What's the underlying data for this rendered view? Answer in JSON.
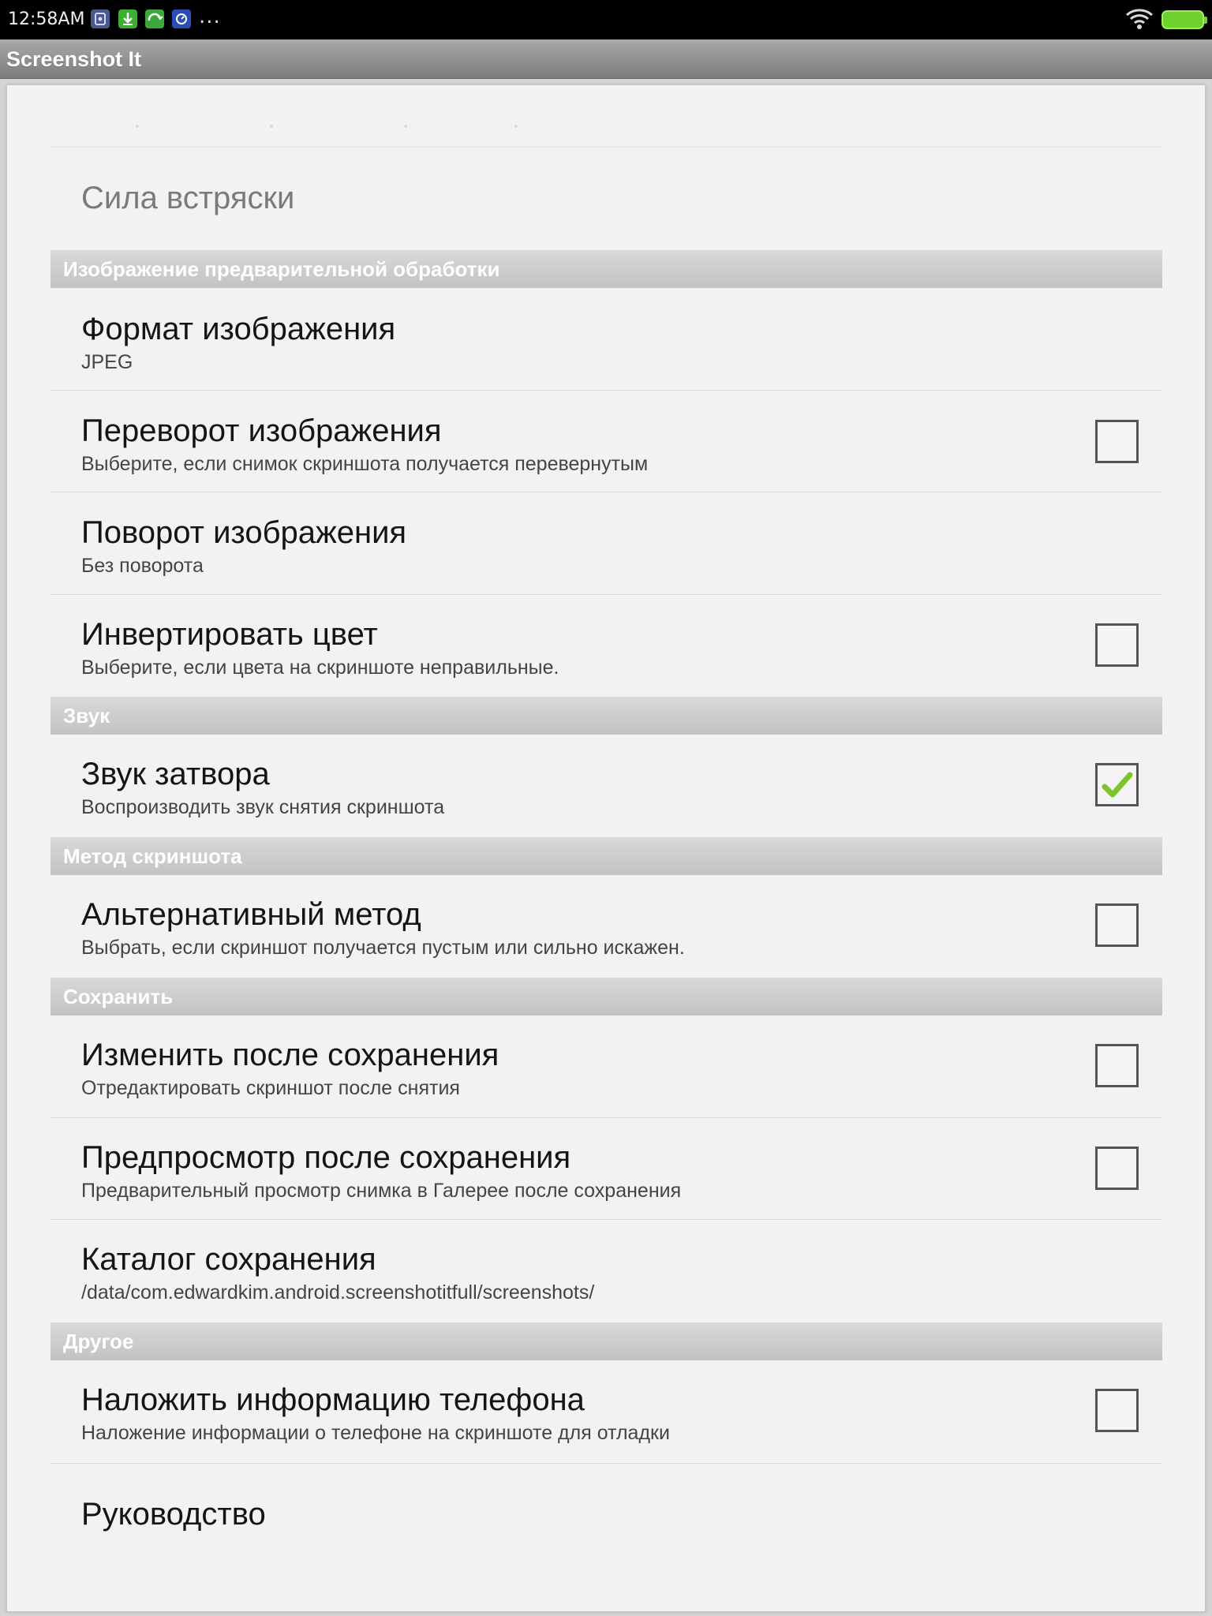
{
  "status_bar": {
    "time": "12:58AM",
    "overflow": "...",
    "notification_icons": [
      "screenshot-icon",
      "download-icon",
      "sync-icon",
      "app-icon"
    ],
    "colors": {
      "background": "#000000",
      "battery": "#6fd12e"
    }
  },
  "app": {
    "title": "Screenshot It"
  },
  "preferences": {
    "shake_strength": {
      "title": "Сила встряски"
    },
    "section_image": {
      "label": "Изображение предварительной обработки"
    },
    "image_format": {
      "title": "Формат изображения",
      "summary": "JPEG"
    },
    "image_flip": {
      "title": "Переворот изображения",
      "summary": "Выберите, если снимок скриншота получается перевернутым",
      "checked": false
    },
    "image_rotation": {
      "title": "Поворот изображения",
      "summary": "Без поворота"
    },
    "invert_color": {
      "title": "Инвертировать цвет",
      "summary": "Выберите, если цвета на скриншоте неправильные.",
      "checked": false
    },
    "section_sound": {
      "label": "Звук"
    },
    "shutter_sound": {
      "title": "Звук затвора",
      "summary": "Воспроизводить звук снятия скриншота",
      "checked": true
    },
    "section_method": {
      "label": "Метод скриншота"
    },
    "alternative_method": {
      "title": "Альтернативный метод",
      "summary": "Выбрать, если скриншот получается пустым или сильно искажен.",
      "checked": false
    },
    "section_save": {
      "label": "Сохранить"
    },
    "edit_after_save": {
      "title": "Изменить после сохранения",
      "summary": "Отредактировать скриншот после снятия",
      "checked": false
    },
    "preview_after_save": {
      "title": "Предпросмотр после сохранения",
      "summary": "Предварительный просмотр снимка в Галерее после сохранения",
      "checked": false
    },
    "save_directory": {
      "title": "Каталог сохранения",
      "summary": "/data/com.edwardkim.android.screenshotitfull/screenshots/"
    },
    "section_other": {
      "label": "Другое"
    },
    "overlay_phone_info": {
      "title": "Наложить информацию телефона",
      "summary": "Наложение информации о телефоне на скриншоте для отладки",
      "checked": false
    },
    "manual": {
      "title": "Руководство"
    }
  },
  "colors": {
    "checkmark": "#7cc42a",
    "section_header_text": "#ffffff",
    "panel_background": "#f2f2f2"
  }
}
